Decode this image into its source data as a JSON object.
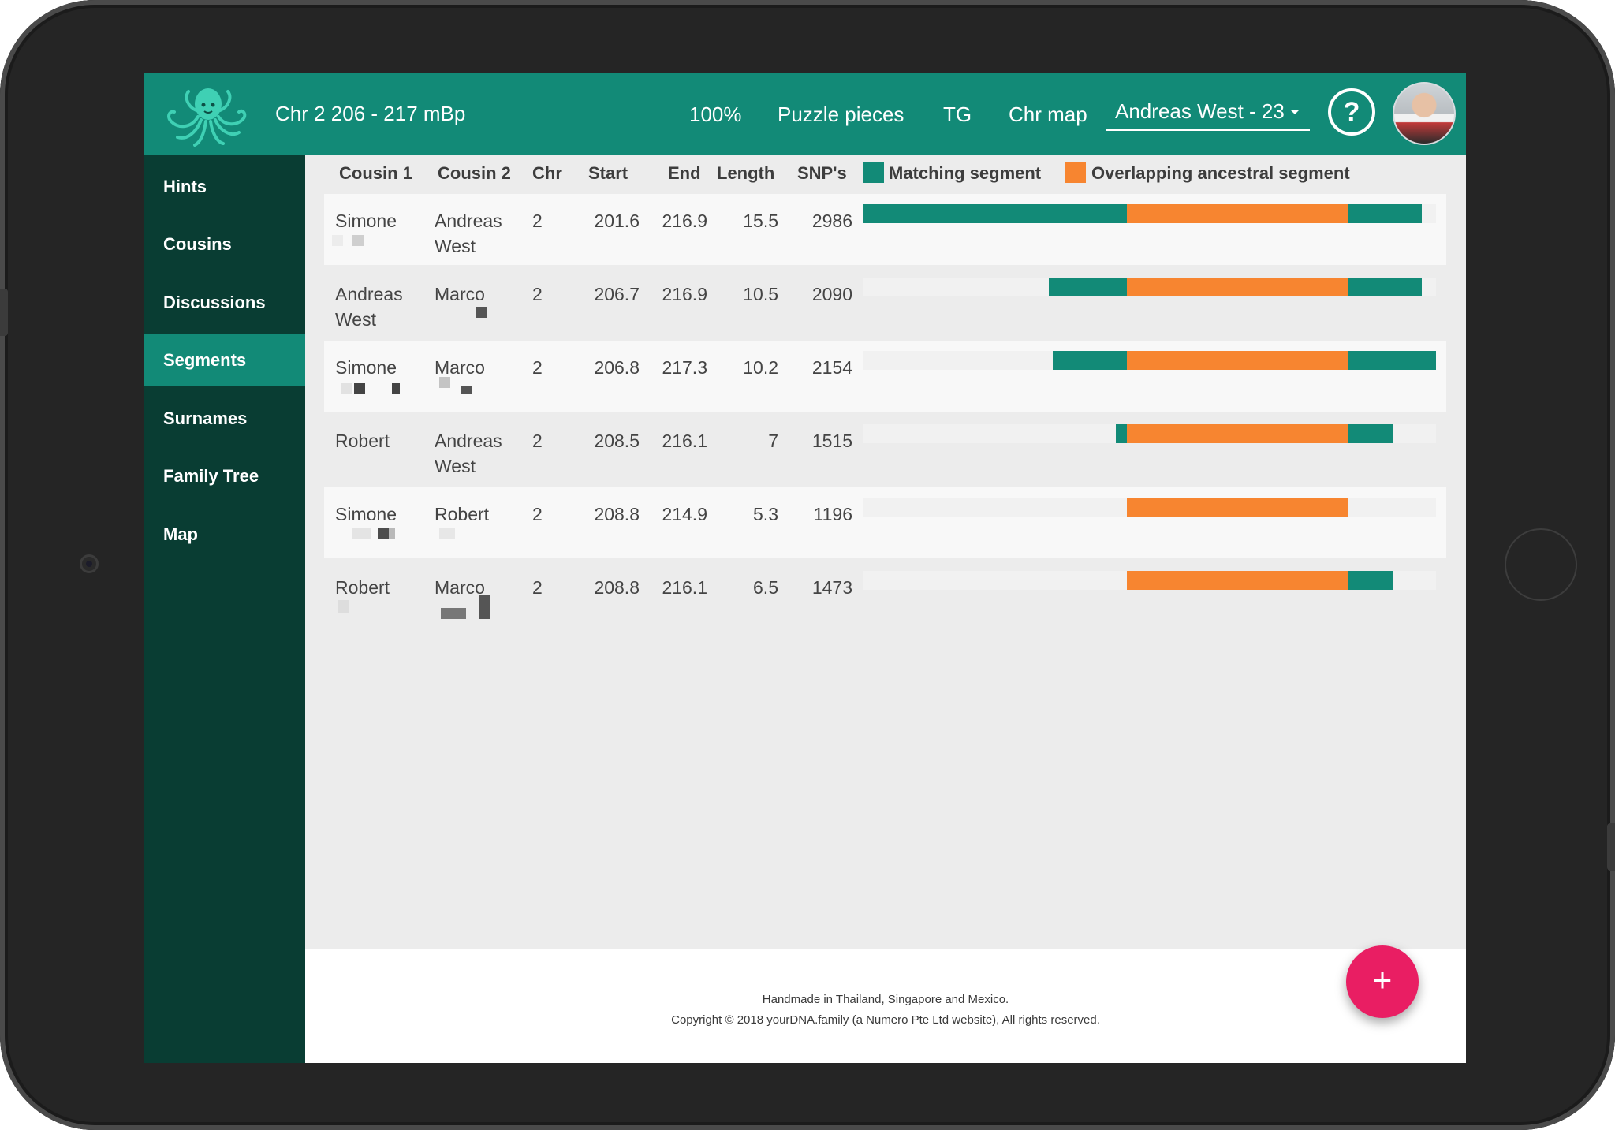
{
  "header": {
    "title": "Chr 2 206 - 217 mBp",
    "nav": [
      "100%",
      "Puzzle pieces",
      "TG",
      "Chr map"
    ],
    "user_select": "Andreas West - 23",
    "help_label": "?",
    "logo_icon": "octopus-logo",
    "colors": {
      "primary": "#128a77",
      "sidebar": "#093d33",
      "accent": "#f78530",
      "fab": "#e91e63"
    }
  },
  "sidebar": {
    "items": [
      {
        "label": "Hints"
      },
      {
        "label": "Cousins"
      },
      {
        "label": "Discussions"
      },
      {
        "label": "Segments",
        "active": true
      },
      {
        "label": "Surnames"
      },
      {
        "label": "Family Tree"
      },
      {
        "label": "Map"
      }
    ]
  },
  "table": {
    "headers": {
      "cousin1": "Cousin 1",
      "cousin2": "Cousin 2",
      "chr": "Chr",
      "start": "Start",
      "end": "End",
      "length": "Length",
      "snps": "SNP's"
    },
    "legend": {
      "matching": "Matching segment",
      "overlap": "Overlapping ancestral segment"
    },
    "rows": [
      {
        "cousin1": "Simone",
        "cousin2": "Andreas West",
        "chr": "2",
        "start": "201.6",
        "end": "216.9",
        "length": "15.5",
        "snps": "2986"
      },
      {
        "cousin1": "Andreas West",
        "cousin2": "Marco",
        "chr": "2",
        "start": "206.7",
        "end": "216.9",
        "length": "10.5",
        "snps": "2090"
      },
      {
        "cousin1": "Simone",
        "cousin2": "Marco",
        "chr": "2",
        "start": "206.8",
        "end": "217.3",
        "length": "10.2",
        "snps": "2154"
      },
      {
        "cousin1": "Robert",
        "cousin2": "Andreas West",
        "chr": "2",
        "start": "208.5",
        "end": "216.1",
        "length": "7",
        "snps": "1515"
      },
      {
        "cousin1": "Simone",
        "cousin2": "Robert",
        "chr": "2",
        "start": "208.8",
        "end": "214.9",
        "length": "5.3",
        "snps": "1196"
      },
      {
        "cousin1": "Robert",
        "cousin2": "Marco",
        "chr": "2",
        "start": "208.8",
        "end": "216.1",
        "length": "6.5",
        "snps": "1473"
      }
    ]
  },
  "footer": {
    "line1": "Handmade in Thailand, Singapore and Mexico.",
    "line2": "Copyright © 2018 yourDNA.family (a Numero Pte Ltd website), All rights reserved."
  },
  "fab_label": "+"
}
